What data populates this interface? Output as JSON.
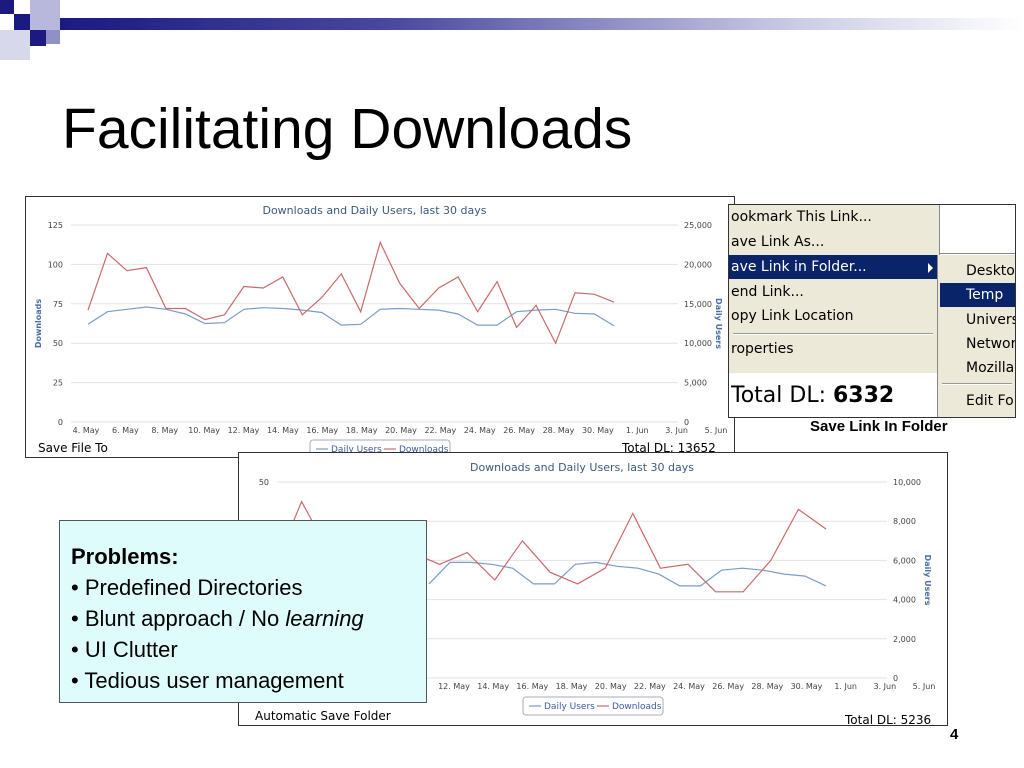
{
  "slide": {
    "title": "Facilitating Downloads",
    "page_number": "4"
  },
  "colors": {
    "daily_users": "#7a9cc8",
    "downloads": "#c86a6a",
    "accent_navy": "#1a1a80",
    "box_fill": "#dffcfc"
  },
  "panels": {
    "top": {
      "label_left": "Save File To",
      "label_right": "Total DL: 13652"
    },
    "bottom": {
      "label_left": "Automatic Save Folder",
      "label_right": "Total DL: 5236"
    }
  },
  "menu": {
    "items": [
      "ookmark This Link...",
      "ave Link As...",
      "ave Link in Folder...",
      "end Link...",
      "opy Link Location",
      "roperties"
    ],
    "selected_index": 2,
    "submenu_items": [
      "Deskto",
      "Temp",
      "Univers",
      "Networ",
      "Mozilla",
      "Edit Fo"
    ],
    "submenu_selected_index": 1,
    "total_label": "Total DL:",
    "total_value": "6332",
    "caption": "Save Link In Folder"
  },
  "problems": {
    "heading": "Problems:",
    "items": [
      {
        "before": "• Predefined Directories",
        "em": "",
        "after": ""
      },
      {
        "before": "• Blunt approach / No ",
        "em": "learning",
        "after": ""
      },
      {
        "before": "• UI Clutter",
        "em": "",
        "after": ""
      },
      {
        "before": "• Tedious user management",
        "em": "",
        "after": ""
      }
    ]
  },
  "chart_data": [
    {
      "type": "line",
      "title": "Downloads and Daily Users, last 30 days",
      "ylabel": "Downloads",
      "y2label": "Daily Users",
      "ylim": [
        0,
        125
      ],
      "y2lim": [
        0,
        25000
      ],
      "yticks": [
        "0",
        "25",
        "50",
        "75",
        "100",
        "125"
      ],
      "y2ticks": [
        "0",
        "5,000",
        "10,000",
        "15,000",
        "20,000",
        "25,000"
      ],
      "xticks": [
        "4. May",
        "6. May",
        "8. May",
        "10. May",
        "12. May",
        "14. May",
        "16. May",
        "18. May",
        "20. May",
        "22. May",
        "24. May",
        "26. May",
        "28. May",
        "30. May",
        "1. Jun",
        "3. Jun",
        "5. Jun"
      ],
      "legend": "bottom-center",
      "series": [
        {
          "name": "Daily Users",
          "axis": "right",
          "values": [
            12400,
            14000,
            14300,
            14600,
            14300,
            13700,
            12500,
            12600,
            14300,
            14500,
            14400,
            14200,
            13900,
            12300,
            12400,
            14300,
            14400,
            14300,
            14200,
            13700,
            12300,
            12300,
            14000,
            14200,
            14300,
            13800,
            13700,
            12200
          ]
        },
        {
          "name": "Downloads",
          "axis": "left",
          "values": [
            71,
            107,
            96,
            98,
            72,
            72,
            65,
            68,
            86,
            85,
            92,
            68,
            79,
            94,
            70,
            114,
            88,
            72,
            85,
            92,
            70,
            89,
            60,
            74,
            50,
            82,
            81,
            76
          ]
        }
      ]
    },
    {
      "type": "line",
      "title": "Downloads and Daily Users, last 30 days",
      "y2label": "Daily Users",
      "ylim": [
        0,
        50
      ],
      "y2lim": [
        0,
        10000
      ],
      "yticks": [
        "50"
      ],
      "y2ticks": [
        "0",
        "2,000",
        "4,000",
        "6,000",
        "8,000",
        "10,000"
      ],
      "xticks": [
        "12. May",
        "14. May",
        "16. May",
        "18. May",
        "20. May",
        "22. May",
        "24. May",
        "26. May",
        "28. May",
        "30. May",
        "1. Jun",
        "3. Jun",
        "5. Jun"
      ],
      "legend": "bottom-center",
      "series": [
        {
          "name": "Daily Users",
          "axis": "right",
          "values": [
            4800,
            5900,
            5900,
            5800,
            5600,
            4800,
            4800,
            5800,
            5900,
            5700,
            5600,
            5300,
            4700,
            4700,
            5500,
            5600,
            5500,
            5300,
            5200,
            4700
          ]
        },
        {
          "name": "Downloads",
          "axis": "left",
          "values": [
            28,
            45,
            32,
            40,
            25,
            32,
            29,
            32,
            25,
            35,
            27,
            24,
            28,
            42,
            28,
            29,
            22,
            22,
            30,
            43,
            38
          ]
        }
      ]
    }
  ]
}
